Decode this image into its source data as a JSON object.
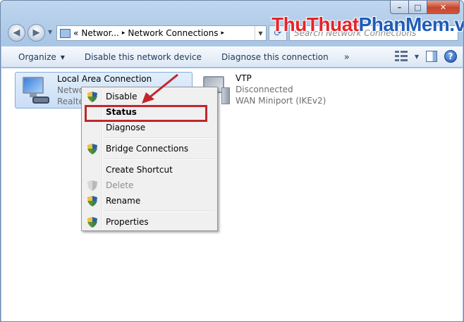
{
  "window": {
    "caption_minimize": "–",
    "caption_maximize": "□",
    "caption_close": "✕"
  },
  "address": {
    "prefix": "«",
    "crumb1": "Networ...",
    "sep1": "▸",
    "crumb2": "Network Connections",
    "sep2": "▸",
    "search_placeholder": "Search Network Connections"
  },
  "watermark": {
    "part1": "Thu",
    "part2": "Thuat",
    "part3": "PhanMem",
    "part4": ".vn"
  },
  "toolbar": {
    "organize": "Organize",
    "disable": "Disable this network device",
    "diagnose": "Diagnose this connection",
    "more": "»",
    "help": "?"
  },
  "connections": [
    {
      "name": "Local Area Connection",
      "status": "Netwo",
      "device": "Realtek"
    },
    {
      "name": "VTP",
      "status": "Disconnected",
      "device": "WAN Miniport (IKEv2)"
    }
  ],
  "context_menu": {
    "items": [
      {
        "label": "Disable",
        "shield": true
      },
      {
        "label": "Status",
        "bold": true
      },
      {
        "label": "Diagnose"
      },
      {
        "label": "Bridge Connections",
        "shield": true
      },
      {
        "label": "Create Shortcut"
      },
      {
        "label": "Delete",
        "shield": true,
        "disabled": true
      },
      {
        "label": "Rename",
        "shield": true
      },
      {
        "label": "Properties",
        "shield": true
      }
    ]
  },
  "colors": {
    "annotation": "#c0272d",
    "watermark_red": "#e3252b",
    "watermark_blue": "#1f5cb8"
  }
}
